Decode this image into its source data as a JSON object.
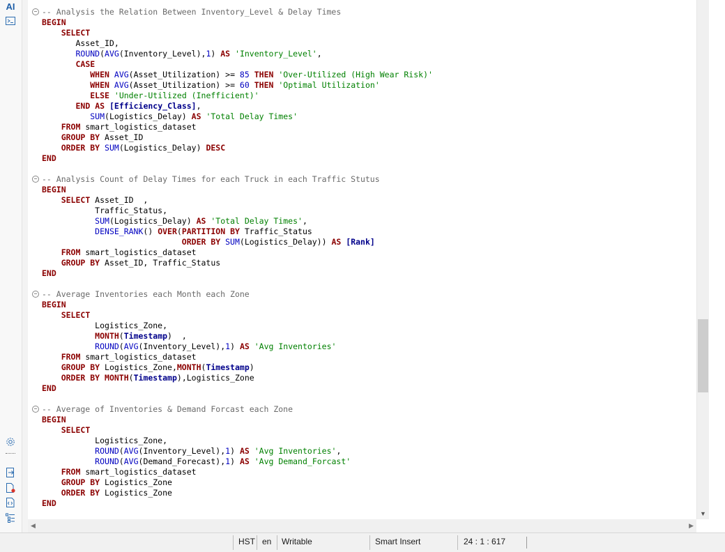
{
  "rail": {
    "top_icons": [
      "ai-icon",
      "terminal-icon"
    ],
    "ai_label": "AI",
    "bottom_icons": [
      "settings-icon",
      "export-icon",
      "file-error-icon",
      "document-code-icon",
      "outline-icon"
    ]
  },
  "code_lines": [
    [
      {
        "c": "cm",
        "t": "-- Analysis the Relation Between Inventory_Level & Delay Times"
      }
    ],
    [
      {
        "c": "kw",
        "t": "BEGIN"
      }
    ],
    [
      {
        "c": "",
        "t": "    "
      },
      {
        "c": "kw",
        "t": "SELECT"
      }
    ],
    [
      {
        "c": "",
        "t": "       Asset_ID,"
      }
    ],
    [
      {
        "c": "",
        "t": "       "
      },
      {
        "c": "fn",
        "t": "ROUND"
      },
      {
        "c": "",
        "t": "("
      },
      {
        "c": "fn",
        "t": "AVG"
      },
      {
        "c": "",
        "t": "(Inventory_Level),"
      },
      {
        "c": "nm",
        "t": "1"
      },
      {
        "c": "",
        "t": ") "
      },
      {
        "c": "kw",
        "t": "AS"
      },
      {
        "c": "",
        "t": " "
      },
      {
        "c": "st",
        "t": "'Inventory_Level'"
      },
      {
        "c": "",
        "t": ","
      }
    ],
    [
      {
        "c": "",
        "t": "       "
      },
      {
        "c": "kw",
        "t": "CASE"
      }
    ],
    [
      {
        "c": "",
        "t": "          "
      },
      {
        "c": "kw",
        "t": "WHEN"
      },
      {
        "c": "",
        "t": " "
      },
      {
        "c": "fn",
        "t": "AVG"
      },
      {
        "c": "",
        "t": "(Asset_Utilization) >= "
      },
      {
        "c": "nm",
        "t": "85"
      },
      {
        "c": "",
        "t": " "
      },
      {
        "c": "kw",
        "t": "THEN"
      },
      {
        "c": "",
        "t": " "
      },
      {
        "c": "st",
        "t": "'Over-Utilized (High Wear Risk)'"
      }
    ],
    [
      {
        "c": "",
        "t": "          "
      },
      {
        "c": "kw",
        "t": "WHEN"
      },
      {
        "c": "",
        "t": " "
      },
      {
        "c": "fn",
        "t": "AVG"
      },
      {
        "c": "",
        "t": "(Asset_Utilization) >= "
      },
      {
        "c": "nm",
        "t": "60"
      },
      {
        "c": "",
        "t": " "
      },
      {
        "c": "kw",
        "t": "THEN"
      },
      {
        "c": "",
        "t": " "
      },
      {
        "c": "st",
        "t": "'Optimal Utilization'"
      }
    ],
    [
      {
        "c": "",
        "t": "          "
      },
      {
        "c": "kw",
        "t": "ELSE"
      },
      {
        "c": "",
        "t": " "
      },
      {
        "c": "st",
        "t": "'Under-Utilized (Inefficient)'"
      }
    ],
    [
      {
        "c": "",
        "t": "       "
      },
      {
        "c": "kw",
        "t": "END"
      },
      {
        "c": "",
        "t": " "
      },
      {
        "c": "kw",
        "t": "AS"
      },
      {
        "c": "",
        "t": " "
      },
      {
        "c": "id",
        "t": "[Efficiency_Class]"
      },
      {
        "c": "",
        "t": ","
      }
    ],
    [
      {
        "c": "",
        "t": "          "
      },
      {
        "c": "fn",
        "t": "SUM"
      },
      {
        "c": "",
        "t": "(Logistics_Delay) "
      },
      {
        "c": "kw",
        "t": "AS"
      },
      {
        "c": "",
        "t": " "
      },
      {
        "c": "st",
        "t": "'Total Delay Times'"
      }
    ],
    [
      {
        "c": "",
        "t": "    "
      },
      {
        "c": "kw",
        "t": "FROM"
      },
      {
        "c": "",
        "t": " smart_logistics_dataset"
      }
    ],
    [
      {
        "c": "",
        "t": "    "
      },
      {
        "c": "kw",
        "t": "GROUP BY"
      },
      {
        "c": "",
        "t": " Asset_ID"
      }
    ],
    [
      {
        "c": "",
        "t": "    "
      },
      {
        "c": "kw",
        "t": "ORDER BY"
      },
      {
        "c": "",
        "t": " "
      },
      {
        "c": "fn",
        "t": "SUM"
      },
      {
        "c": "",
        "t": "(Logistics_Delay) "
      },
      {
        "c": "kw",
        "t": "DESC"
      }
    ],
    [
      {
        "c": "kw",
        "t": "END"
      }
    ],
    [],
    [
      {
        "c": "cm",
        "t": "-- Analysis Count of Delay Times for each Truck in each Traffic Stutus"
      }
    ],
    [
      {
        "c": "kw",
        "t": "BEGIN"
      }
    ],
    [
      {
        "c": "",
        "t": "    "
      },
      {
        "c": "kw",
        "t": "SELECT"
      },
      {
        "c": "",
        "t": " Asset_ID  ,"
      }
    ],
    [
      {
        "c": "",
        "t": "           Traffic_Status,"
      }
    ],
    [
      {
        "c": "",
        "t": "           "
      },
      {
        "c": "fn",
        "t": "SUM"
      },
      {
        "c": "",
        "t": "(Logistics_Delay) "
      },
      {
        "c": "kw",
        "t": "AS"
      },
      {
        "c": "",
        "t": " "
      },
      {
        "c": "st",
        "t": "'Total Delay Times'"
      },
      {
        "c": "",
        "t": ","
      }
    ],
    [
      {
        "c": "",
        "t": "           "
      },
      {
        "c": "fn",
        "t": "DENSE_RANK"
      },
      {
        "c": "",
        "t": "() "
      },
      {
        "c": "kw",
        "t": "OVER"
      },
      {
        "c": "",
        "t": "("
      },
      {
        "c": "kw",
        "t": "PARTITION BY"
      },
      {
        "c": "",
        "t": " Traffic_Status"
      }
    ],
    [
      {
        "c": "",
        "t": "                             "
      },
      {
        "c": "kw",
        "t": "ORDER BY"
      },
      {
        "c": "",
        "t": " "
      },
      {
        "c": "fn",
        "t": "SUM"
      },
      {
        "c": "",
        "t": "(Logistics_Delay)) "
      },
      {
        "c": "kw",
        "t": "AS"
      },
      {
        "c": "",
        "t": " "
      },
      {
        "c": "id",
        "t": "[Rank]"
      }
    ],
    [
      {
        "c": "",
        "t": "    "
      },
      {
        "c": "kw",
        "t": "FROM"
      },
      {
        "c": "",
        "t": " smart_logistics_dataset"
      }
    ],
    [
      {
        "c": "",
        "t": "    "
      },
      {
        "c": "kw",
        "t": "GROUP BY"
      },
      {
        "c": "",
        "t": " Asset_ID, Traffic_Status"
      }
    ],
    [
      {
        "c": "kw",
        "t": "END"
      }
    ],
    [],
    [
      {
        "c": "cm",
        "t": "-- Average Inventories each Month each Zone"
      }
    ],
    [
      {
        "c": "kw",
        "t": "BEGIN"
      }
    ],
    [
      {
        "c": "",
        "t": "    "
      },
      {
        "c": "kw",
        "t": "SELECT"
      }
    ],
    [
      {
        "c": "",
        "t": "           Logistics_Zone,"
      }
    ],
    [
      {
        "c": "",
        "t": "           "
      },
      {
        "c": "kw",
        "t": "MONTH"
      },
      {
        "c": "",
        "t": "("
      },
      {
        "c": "id",
        "t": "Timestamp"
      },
      {
        "c": "",
        "t": ")  ,"
      }
    ],
    [
      {
        "c": "",
        "t": "           "
      },
      {
        "c": "fn",
        "t": "ROUND"
      },
      {
        "c": "",
        "t": "("
      },
      {
        "c": "fn",
        "t": "AVG"
      },
      {
        "c": "",
        "t": "(Inventory_Level),"
      },
      {
        "c": "nm",
        "t": "1"
      },
      {
        "c": "",
        "t": ") "
      },
      {
        "c": "kw",
        "t": "AS"
      },
      {
        "c": "",
        "t": " "
      },
      {
        "c": "st",
        "t": "'Avg Inventories'"
      }
    ],
    [
      {
        "c": "",
        "t": "    "
      },
      {
        "c": "kw",
        "t": "FROM"
      },
      {
        "c": "",
        "t": " smart_logistics_dataset"
      }
    ],
    [
      {
        "c": "",
        "t": "    "
      },
      {
        "c": "kw",
        "t": "GROUP BY"
      },
      {
        "c": "",
        "t": " Logistics_Zone,"
      },
      {
        "c": "kw",
        "t": "MONTH"
      },
      {
        "c": "",
        "t": "("
      },
      {
        "c": "id",
        "t": "Timestamp"
      },
      {
        "c": "",
        "t": ")"
      }
    ],
    [
      {
        "c": "",
        "t": "    "
      },
      {
        "c": "kw",
        "t": "ORDER BY"
      },
      {
        "c": "",
        "t": " "
      },
      {
        "c": "kw",
        "t": "MONTH"
      },
      {
        "c": "",
        "t": "("
      },
      {
        "c": "id",
        "t": "Timestamp"
      },
      {
        "c": "",
        "t": "),Logistics_Zone"
      }
    ],
    [
      {
        "c": "kw",
        "t": "END"
      }
    ],
    [],
    [
      {
        "c": "cm",
        "t": "-- Average of Inventories & Demand Forcast each Zone"
      }
    ],
    [
      {
        "c": "kw",
        "t": "BEGIN"
      }
    ],
    [
      {
        "c": "",
        "t": "    "
      },
      {
        "c": "kw",
        "t": "SELECT"
      }
    ],
    [
      {
        "c": "",
        "t": "           Logistics_Zone,"
      }
    ],
    [
      {
        "c": "",
        "t": "           "
      },
      {
        "c": "fn",
        "t": "ROUND"
      },
      {
        "c": "",
        "t": "("
      },
      {
        "c": "fn",
        "t": "AVG"
      },
      {
        "c": "",
        "t": "(Inventory_Level),"
      },
      {
        "c": "nm",
        "t": "1"
      },
      {
        "c": "",
        "t": ") "
      },
      {
        "c": "kw",
        "t": "AS"
      },
      {
        "c": "",
        "t": " "
      },
      {
        "c": "st",
        "t": "'Avg Inventories'"
      },
      {
        "c": "",
        "t": ","
      }
    ],
    [
      {
        "c": "",
        "t": "           "
      },
      {
        "c": "fn",
        "t": "ROUND"
      },
      {
        "c": "",
        "t": "("
      },
      {
        "c": "fn",
        "t": "AVG"
      },
      {
        "c": "",
        "t": "(Demand_Forecast),"
      },
      {
        "c": "nm",
        "t": "1"
      },
      {
        "c": "",
        "t": ") "
      },
      {
        "c": "kw",
        "t": "AS"
      },
      {
        "c": "",
        "t": " "
      },
      {
        "c": "st",
        "t": "'Avg Demand_Forcast'"
      }
    ],
    [
      {
        "c": "",
        "t": "    "
      },
      {
        "c": "kw",
        "t": "FROM"
      },
      {
        "c": "",
        "t": " smart_logistics_dataset"
      }
    ],
    [
      {
        "c": "",
        "t": "    "
      },
      {
        "c": "kw",
        "t": "GROUP BY"
      },
      {
        "c": "",
        "t": " Logistics_Zone"
      }
    ],
    [
      {
        "c": "",
        "t": "    "
      },
      {
        "c": "kw",
        "t": "ORDER BY"
      },
      {
        "c": "",
        "t": " Logistics_Zone"
      }
    ],
    [
      {
        "c": "kw",
        "t": "END"
      }
    ]
  ],
  "fold_lines": [
    0,
    16,
    27,
    38
  ],
  "status": {
    "hst": "HST",
    "lang": "en",
    "mode": "Writable",
    "insert": "Smart Insert",
    "position": "24 : 1 : 617"
  },
  "colors": {
    "keyword": "#8b0000",
    "function": "#0000c0",
    "comment": "#6a6a6a",
    "string": "#008000"
  }
}
